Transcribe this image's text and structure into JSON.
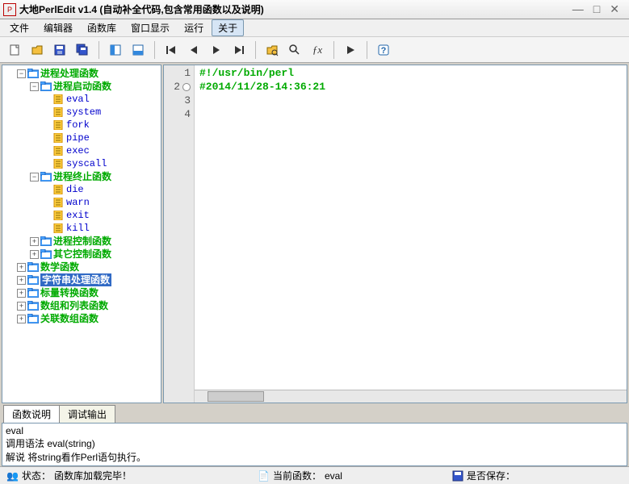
{
  "window": {
    "title": "大地PerlEdit v1.4 (自动补全代码,包含常用函数以及说明)"
  },
  "menu": {
    "items": [
      "文件",
      "编辑器",
      "函数库",
      "窗口显示",
      "运行",
      "关于"
    ],
    "active_index": 5
  },
  "toolbar": {
    "icons": [
      "new-file",
      "open-file",
      "save-file",
      "save-all",
      "panel-left",
      "panel-bottom",
      "nav-first",
      "nav-prev",
      "nav-next",
      "nav-last",
      "find",
      "find-replace",
      "fx",
      "run",
      "help"
    ]
  },
  "tree": {
    "root": [
      {
        "label": "进程处理函数",
        "type": "folder",
        "expanded": true,
        "depth": 0,
        "children": [
          {
            "label": "进程启动函数",
            "type": "folder",
            "expanded": true,
            "depth": 1,
            "children": [
              {
                "label": "eval",
                "type": "leaf",
                "depth": 2
              },
              {
                "label": "system",
                "type": "leaf",
                "depth": 2
              },
              {
                "label": "fork",
                "type": "leaf",
                "depth": 2
              },
              {
                "label": "pipe",
                "type": "leaf",
                "depth": 2
              },
              {
                "label": "exec",
                "type": "leaf",
                "depth": 2
              },
              {
                "label": "syscall",
                "type": "leaf",
                "depth": 2
              }
            ]
          },
          {
            "label": "进程终止函数",
            "type": "folder",
            "expanded": true,
            "depth": 1,
            "children": [
              {
                "label": "die",
                "type": "leaf",
                "depth": 2
              },
              {
                "label": "warn",
                "type": "leaf",
                "depth": 2
              },
              {
                "label": "exit",
                "type": "leaf",
                "depth": 2
              },
              {
                "label": "kill",
                "type": "leaf",
                "depth": 2
              }
            ]
          },
          {
            "label": "进程控制函数",
            "type": "folder",
            "expanded": false,
            "depth": 1
          },
          {
            "label": "其它控制函数",
            "type": "folder",
            "expanded": false,
            "depth": 1
          }
        ]
      },
      {
        "label": "数学函数",
        "type": "folder",
        "expanded": false,
        "depth": 0
      },
      {
        "label": "字符串处理函数",
        "type": "folder",
        "expanded": false,
        "depth": 0,
        "selected": true
      },
      {
        "label": "标量转换函数",
        "type": "folder",
        "expanded": false,
        "depth": 0
      },
      {
        "label": "数组和列表函数",
        "type": "folder",
        "expanded": false,
        "depth": 0
      },
      {
        "label": "关联数组函数",
        "type": "folder",
        "expanded": false,
        "depth": 0
      }
    ]
  },
  "editor": {
    "lines": [
      {
        "n": 1,
        "text": "#!/usr/bin/perl"
      },
      {
        "n": 2,
        "text": "#2014/11/28-14:36:21",
        "bp": true
      },
      {
        "n": 3,
        "text": ""
      },
      {
        "n": 4,
        "text": ""
      }
    ]
  },
  "bottom_tabs": {
    "items": [
      "函数说明",
      "调试输出"
    ],
    "active_index": 0
  },
  "description": {
    "lines": [
      "eval",
      "调用语法 eval(string)",
      "解说 将string看作Perl语句执行。"
    ]
  },
  "status": {
    "state_label": "状态：",
    "state_value": "函数库加载完毕！",
    "current_fn_label": "当前函数：",
    "current_fn_value": "eval",
    "saved_label": "是否保存："
  }
}
